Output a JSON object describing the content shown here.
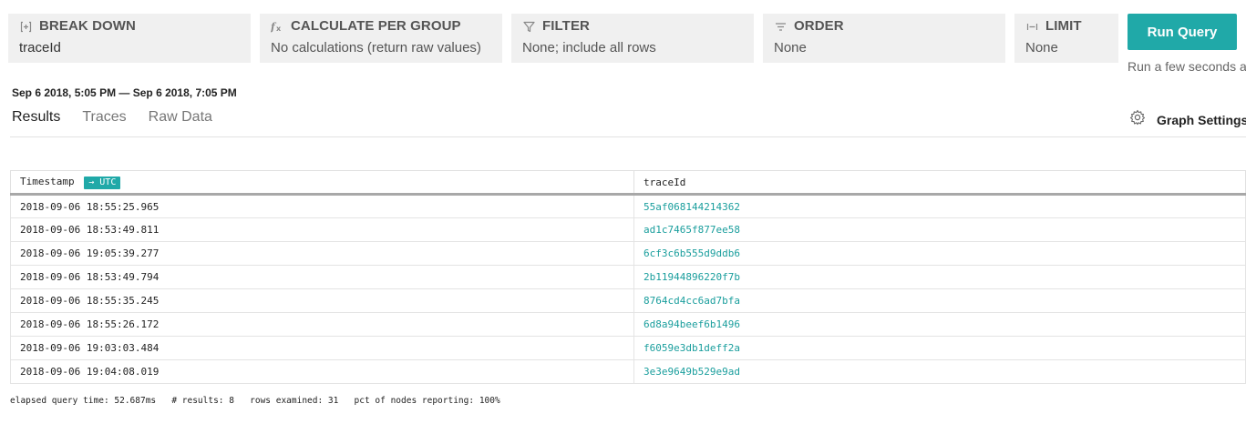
{
  "query": {
    "breakdown": {
      "title": "BREAK DOWN",
      "value": "traceId"
    },
    "calculate": {
      "title": "CALCULATE PER GROUP",
      "value": "No calculations (return raw values)"
    },
    "filter": {
      "title": "FILTER",
      "value": "None; include all rows"
    },
    "order": {
      "title": "ORDER",
      "value": "None"
    },
    "limit": {
      "title": "LIMIT",
      "value": "None"
    },
    "run_label": "Run Query",
    "run_hint": "Run a few seconds ag"
  },
  "time_range": "Sep 6 2018, 5:05 PM — Sep 6 2018, 7:05 PM",
  "tabs": [
    "Results",
    "Traces",
    "Raw Data"
  ],
  "graph_settings_label": "Graph Settings",
  "table": {
    "columns": [
      "Timestamp",
      "traceId"
    ],
    "tz_badge": "→ UTC",
    "rows": [
      [
        "2018-09-06 18:55:25.965",
        "55af068144214362"
      ],
      [
        "2018-09-06 18:53:49.811",
        "ad1c7465f877ee58"
      ],
      [
        "2018-09-06 19:05:39.277",
        "6cf3c6b555d9ddb6"
      ],
      [
        "2018-09-06 18:53:49.794",
        "2b11944896220f7b"
      ],
      [
        "2018-09-06 18:55:35.245",
        "8764cd4cc6ad7bfa"
      ],
      [
        "2018-09-06 18:55:26.172",
        "6d8a94beef6b1496"
      ],
      [
        "2018-09-06 19:03:03.484",
        "f6059e3db1deff2a"
      ],
      [
        "2018-09-06 19:04:08.019",
        "3e3e9649b529e9ad"
      ]
    ]
  },
  "stats": {
    "elapsed": "elapsed query time: 52.687ms",
    "results": "# results: 8",
    "rows_examined": "rows examined: 31",
    "pct_nodes": "pct of nodes reporting: 100%"
  },
  "colors": {
    "accent": "#20a9a8",
    "trace_text": "#1a9e9d",
    "clause_bg": "#f0f0f0"
  }
}
